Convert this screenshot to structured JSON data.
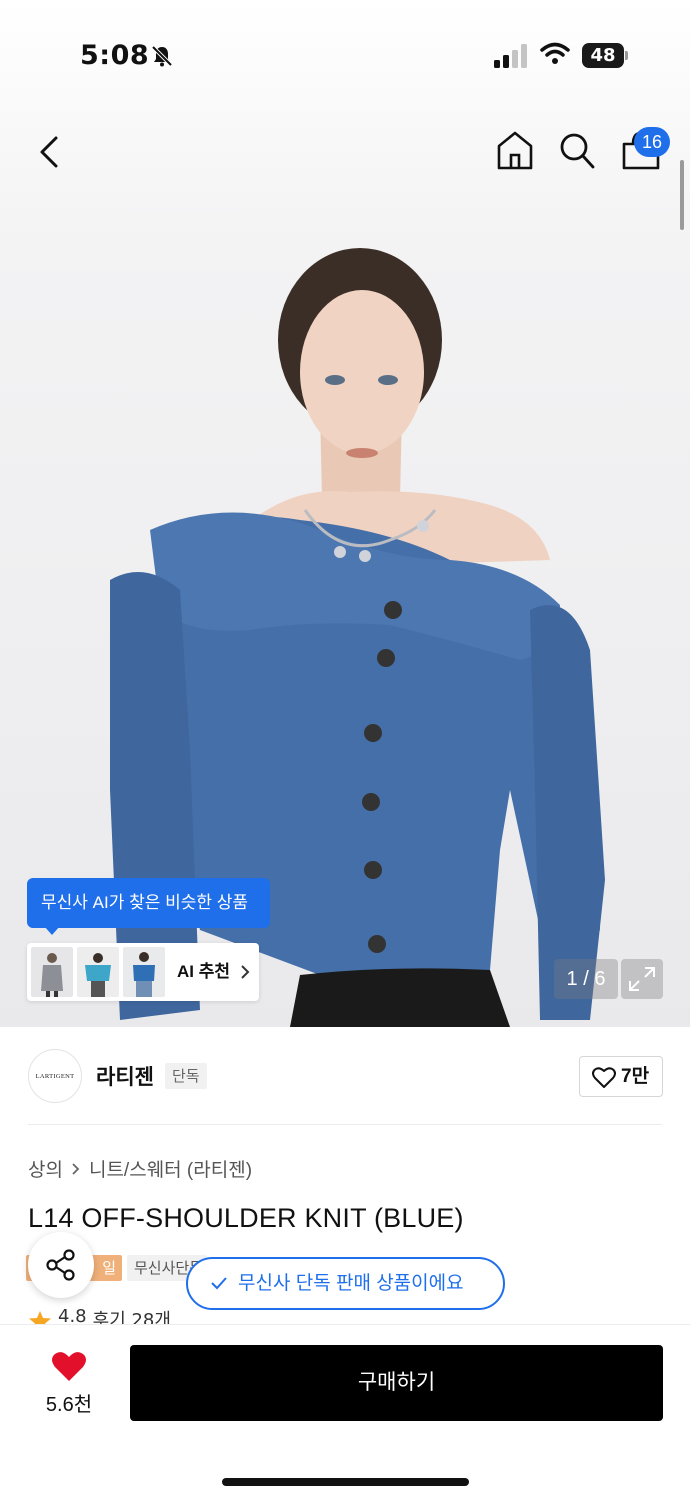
{
  "status_bar": {
    "time": "5:08",
    "battery": "48",
    "icons": [
      "bell-mute-icon",
      "signal-icon",
      "wifi-icon",
      "battery-icon"
    ]
  },
  "nav": {
    "icons": [
      "back-icon",
      "home-icon",
      "search-icon",
      "bag-icon"
    ],
    "cart_badge": "16"
  },
  "gallery": {
    "counter": "1 / 6",
    "ai_bubble": "무신사 AI가 찾은 비슷한 상품",
    "ai_recommend_label": "AI 추천"
  },
  "brand": {
    "logo_text": "LARTIGENT",
    "name": "라티젠",
    "exclusive_tag": "단독",
    "likes": "7만"
  },
  "product": {
    "breadcrumb": [
      "상의",
      "니트/스웨터 (라티젠)"
    ],
    "title": "L14 OFF-SHOULDER KNIT (BLUE)",
    "orange_tag": "일",
    "gray_tag": "무신사단독",
    "toast": "무신사 단독 판매 상품이에요",
    "rating": "4.8",
    "reviews": "후기 28개"
  },
  "bottom_bar": {
    "wish_count": "5.6천",
    "buy_label": "구매하기"
  },
  "colors": {
    "accent_blue": "#1f6feb",
    "heart_red": "#e3102b",
    "buy_button": "#000000"
  }
}
